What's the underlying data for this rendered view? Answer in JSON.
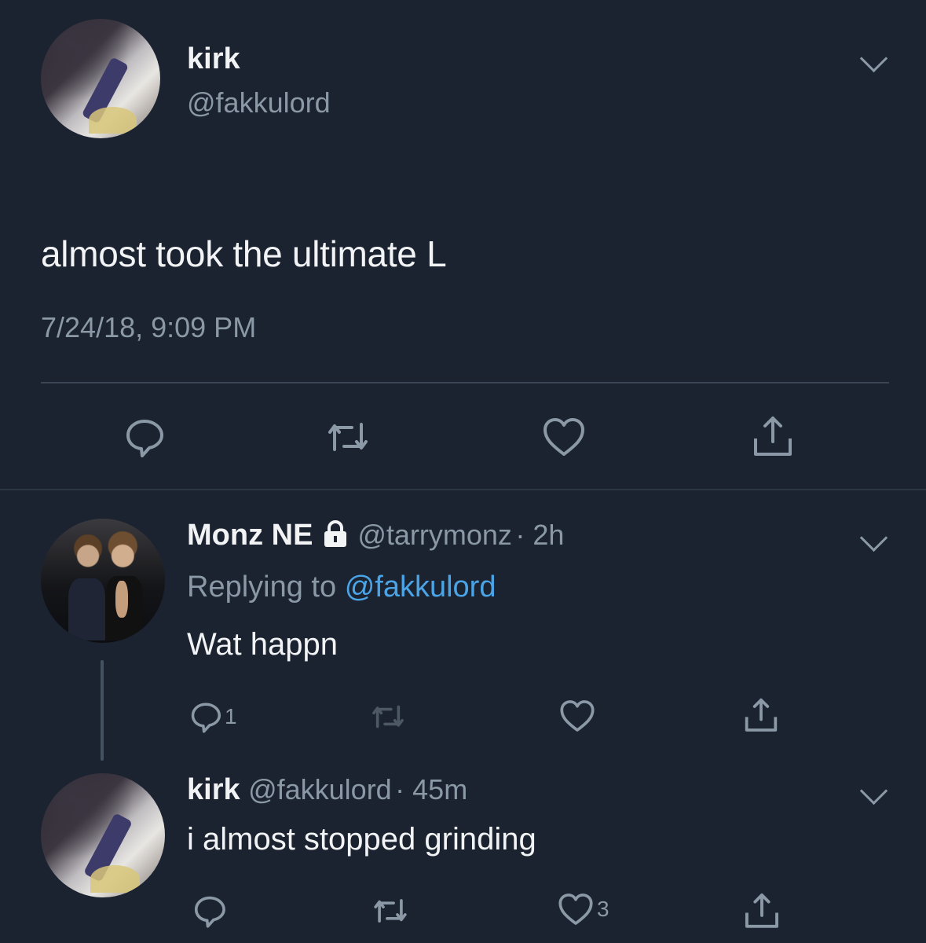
{
  "main_tweet": {
    "author_name": "kirk",
    "author_handle": "@fakkulord",
    "text": "almost took the ultimate L",
    "timestamp": "7/24/18, 9:09 PM",
    "actions": [
      "reply-icon",
      "retweet-icon",
      "like-icon",
      "share-icon"
    ]
  },
  "replies": [
    {
      "author_name": "Monz NE",
      "protected_icon": "lock-icon",
      "author_handle": "@tarrymonz",
      "time": "2h",
      "replying_label": "Replying to",
      "replying_to": "@fakkulord",
      "text": "Wat happn",
      "reply_count": "1",
      "like_count": ""
    },
    {
      "author_name": "kirk",
      "author_handle": "@fakkulord",
      "time": "45m",
      "text": "i almost stopped grinding",
      "reply_count": "",
      "like_count": "3"
    }
  ],
  "colors": {
    "background": "#1b2331",
    "text": "#f2f3f5",
    "muted": "#8b98a5",
    "link": "#4aa4e6",
    "divider": "#3a4452"
  }
}
